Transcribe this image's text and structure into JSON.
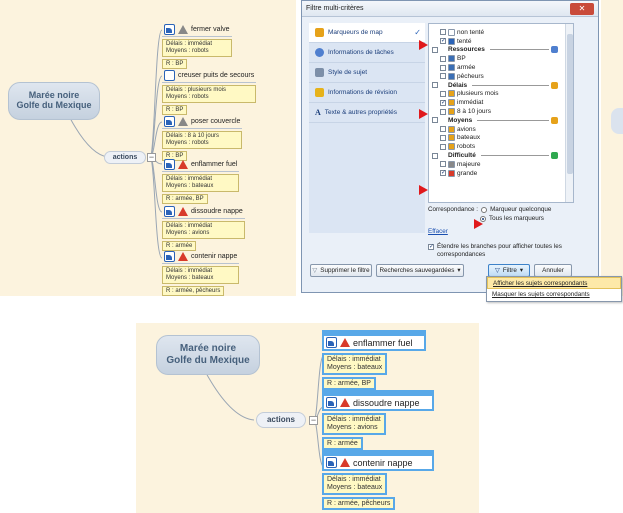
{
  "mindmap": {
    "central_title_line1": "Marée noire",
    "central_title_line2": "Golfe du Mexique",
    "actions_label": "actions",
    "collapse_symbol": "−",
    "topics": [
      {
        "title": "fermer valve",
        "notes": [
          "Délais : immédiat",
          "Moyens : robots"
        ],
        "resource": "R : BP",
        "icon": "task-icon",
        "priority": "gray"
      },
      {
        "title": "creuser puits de secours",
        "notes": [
          "Délais : plusieurs mois",
          "Moyens : robots"
        ],
        "resource": "R : BP",
        "icon": "empty-task-icon",
        "priority": "none"
      },
      {
        "title": "poser couvercle",
        "notes": [
          "Délais : 8 à 10 jours",
          "Moyens : robots"
        ],
        "resource": "R : BP",
        "icon": "task-icon",
        "priority": "gray"
      },
      {
        "title": "enflammer fuel",
        "notes": [
          "Délais : immédiat",
          "Moyens : bateaux"
        ],
        "resource": "R : armée, BP",
        "icon": "task-icon",
        "priority": "red"
      },
      {
        "title": "dissoudre nappe",
        "notes": [
          "Délais : immédiat",
          "Moyens : avions"
        ],
        "resource": "R : armée",
        "icon": "task-icon",
        "priority": "red"
      },
      {
        "title": "contenir nappe",
        "notes": [
          "Délais : immédiat",
          "Moyens : bateaux"
        ],
        "resource": "R : armée, pêcheurs",
        "icon": "task-icon",
        "priority": "red"
      }
    ]
  },
  "dialog": {
    "title": "Filtre multi-critères",
    "close_glyph": "✕",
    "categories": [
      {
        "label": "Marqueurs de map",
        "active": true,
        "check": "✓",
        "color": "#e6a21a"
      },
      {
        "label": "Informations de tâches",
        "active": false,
        "color": "#4f7fcf"
      },
      {
        "label": "Style de sujet",
        "active": false,
        "color": "#7d8fa8"
      },
      {
        "label": "Informations de révision",
        "active": false,
        "color": "#e6b21a"
      },
      {
        "label": "Texte & autres propriétés",
        "active": false,
        "color": "#1a3d7a",
        "glyph": "A"
      }
    ],
    "tree": [
      {
        "kind": "item",
        "label": "non tenté",
        "checked": false,
        "marker": "#ffffff"
      },
      {
        "kind": "item",
        "label": "tenté",
        "checked": true,
        "marker": "#2a63b8"
      },
      {
        "kind": "group",
        "label": "Ressources",
        "icon": "#4f7fcf"
      },
      {
        "kind": "item",
        "label": "BP",
        "checked": false,
        "marker": "#3b6fb6"
      },
      {
        "kind": "item",
        "label": "armée",
        "checked": false,
        "marker": "#3b6fb6"
      },
      {
        "kind": "item",
        "label": "pêcheurs",
        "checked": false,
        "marker": "#3b6fb6"
      },
      {
        "kind": "group",
        "label": "Délais",
        "icon": "#e6a21a"
      },
      {
        "kind": "item",
        "label": "plusieurs mois",
        "checked": false,
        "marker": "#e6a21a"
      },
      {
        "kind": "item",
        "label": "immédiat",
        "checked": true,
        "marker": "#e6a21a"
      },
      {
        "kind": "item",
        "label": "8 à 10 jours",
        "checked": false,
        "marker": "#e6a21a"
      },
      {
        "kind": "group",
        "label": "Moyens",
        "icon": "#e6a21a"
      },
      {
        "kind": "item",
        "label": "avions",
        "checked": false,
        "marker": "#e6a21a"
      },
      {
        "kind": "item",
        "label": "bateaux",
        "checked": false,
        "marker": "#e6a21a"
      },
      {
        "kind": "item",
        "label": "robots",
        "checked": false,
        "marker": "#e6a21a"
      },
      {
        "kind": "group",
        "label": "Difficulté",
        "icon": "#2fa84f"
      },
      {
        "kind": "item",
        "label": "majeure",
        "checked": false,
        "marker": "#888888"
      },
      {
        "kind": "item",
        "label": "grande",
        "checked": true,
        "marker": "#d83a2a"
      }
    ],
    "correspondance_label": "Correspondance :",
    "option_any": "Marqueur quelconque",
    "option_all": "Tous les marqueurs",
    "clear_link": "Effacer",
    "extend_label": "Étendre les branches pour afficher toutes les correspondances",
    "extend_checked": true,
    "remove_filter_button": "Supprimer le filtre",
    "saved_searches_button": "Recherches sauvegardées",
    "filter_button": "Filtre",
    "cancel_button": "Annuler",
    "menu_show": "Afficher les sujets correspondants",
    "menu_hide": "Masquer les sujets correspondants"
  }
}
